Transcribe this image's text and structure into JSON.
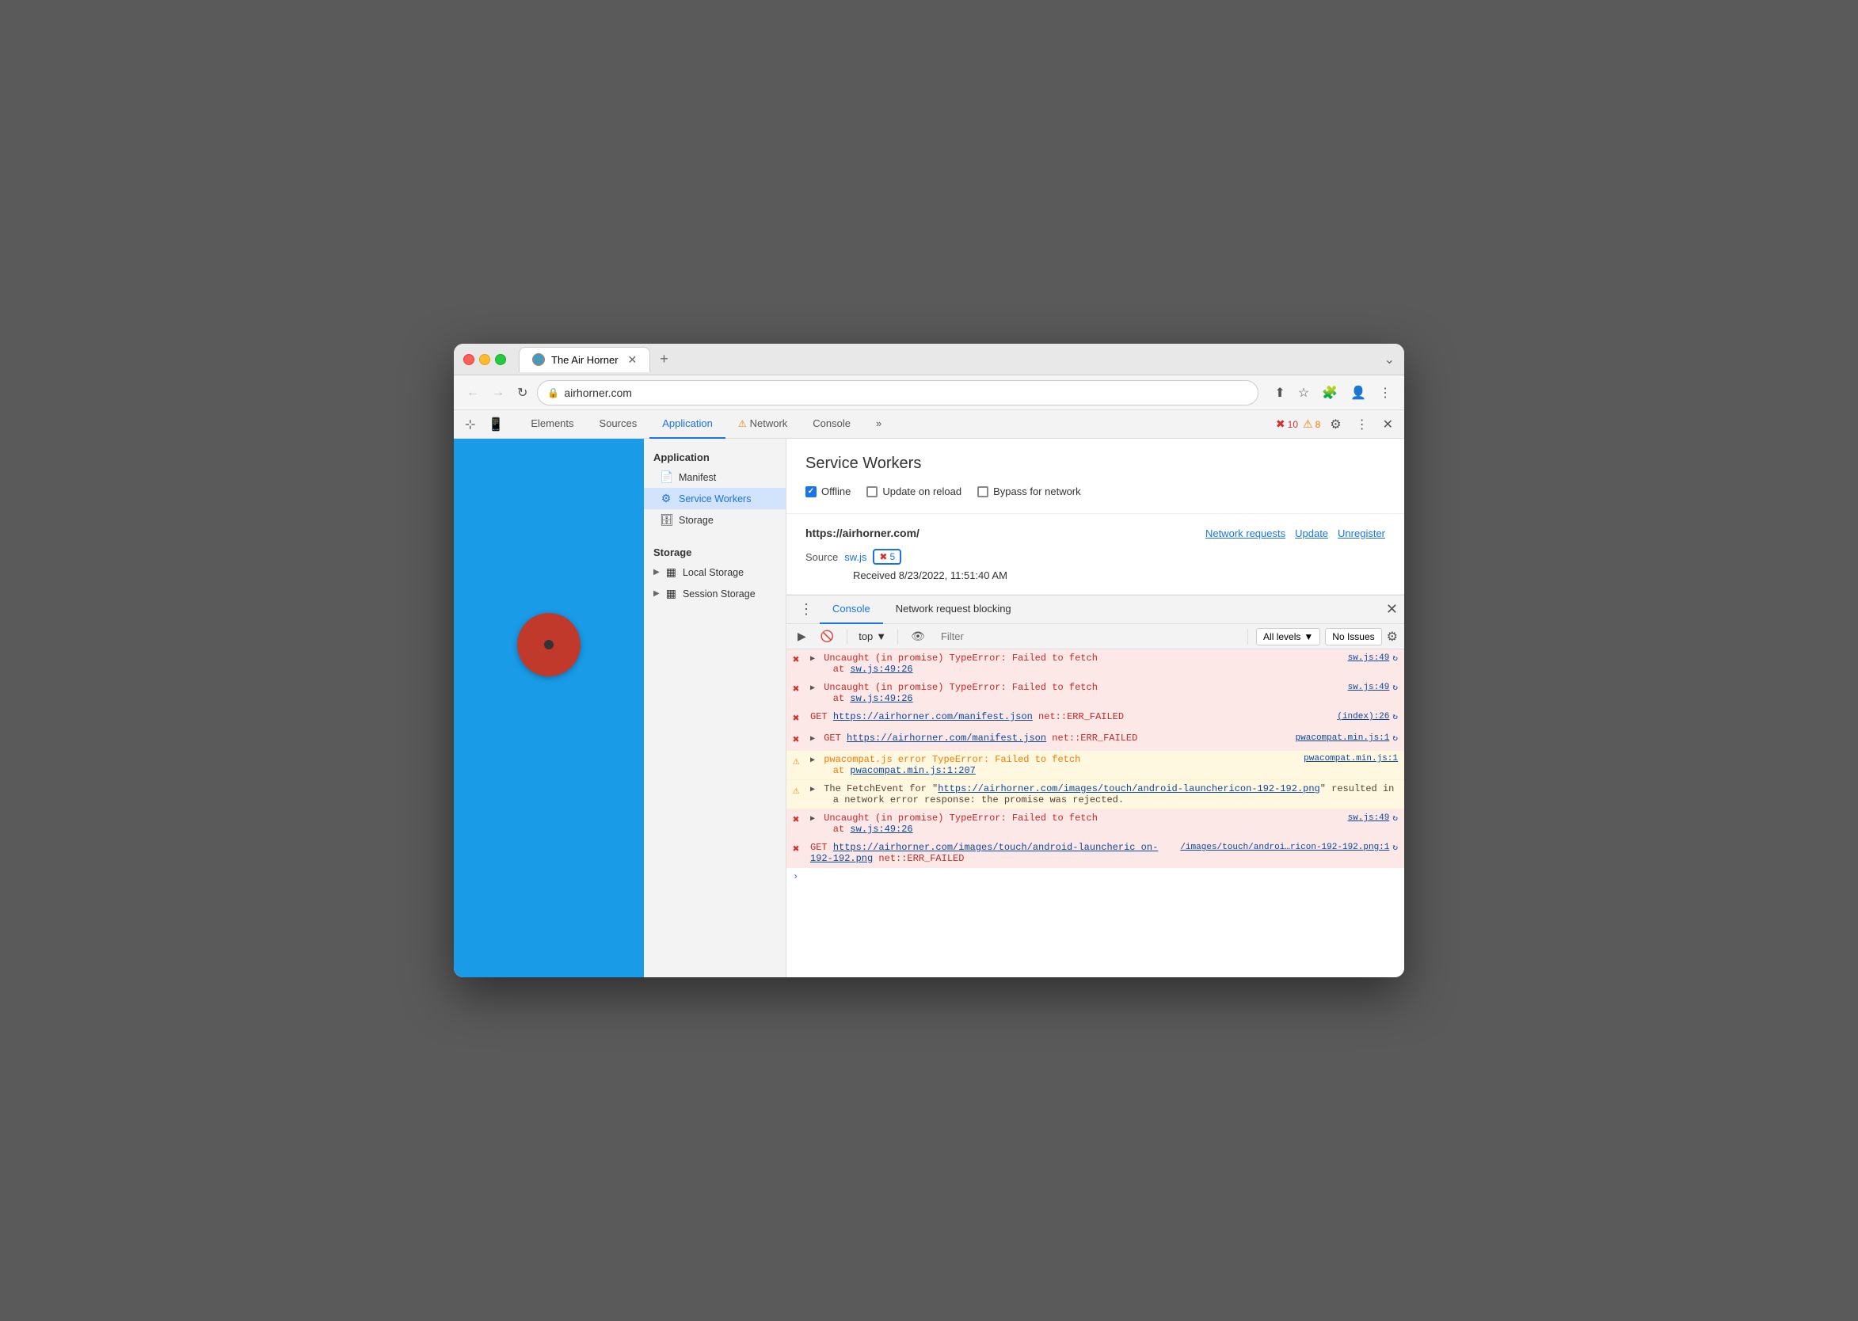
{
  "window": {
    "title": "The Air Horner",
    "close_label": "✕",
    "new_tab_label": "+"
  },
  "addressbar": {
    "url": "airhorner.com",
    "back_label": "←",
    "forward_label": "→",
    "refresh_label": "↻"
  },
  "devtools": {
    "tabs": [
      {
        "id": "elements",
        "label": "Elements"
      },
      {
        "id": "sources",
        "label": "Sources"
      },
      {
        "id": "application",
        "label": "Application"
      },
      {
        "id": "network",
        "label": "Network"
      },
      {
        "id": "console",
        "label": "Console"
      }
    ],
    "active_tab": "application",
    "more_tabs_label": "»",
    "error_count": "10",
    "warning_count": "8",
    "settings_label": "⚙",
    "more_label": "⋮",
    "close_label": "✕"
  },
  "sidebar": {
    "section1_title": "Application",
    "items": [
      {
        "id": "manifest",
        "label": "Manifest",
        "icon": "📄"
      },
      {
        "id": "service-workers",
        "label": "Service Workers",
        "icon": "⚙",
        "active": true
      },
      {
        "id": "storage",
        "label": "Storage",
        "icon": "🗄"
      }
    ],
    "section2_title": "Storage",
    "storage_items": [
      {
        "id": "local-storage",
        "label": "Local Storage",
        "icon": "▦"
      },
      {
        "id": "session-storage",
        "label": "Session Storage",
        "icon": "▦"
      }
    ]
  },
  "service_workers_panel": {
    "title": "Service Workers",
    "offline_label": "Offline",
    "offline_checked": true,
    "update_on_reload_label": "Update on reload",
    "update_on_reload_checked": false,
    "bypass_for_network_label": "Bypass for network",
    "bypass_for_network_checked": false,
    "url": "https://airhorner.com/",
    "network_requests_label": "Network requests",
    "update_label": "Update",
    "unregister_label": "Unregister",
    "source_label": "Source",
    "source_file": "sw.js",
    "error_count": "5",
    "received_label": "Received 8/23/2022, 11:51:40 AM"
  },
  "console_panel": {
    "tab_label": "Console",
    "network_blocking_label": "Network request blocking",
    "close_label": "✕",
    "filter_placeholder": "Filter",
    "top_context": "top",
    "all_levels_label": "All levels",
    "no_issues_label": "No Issues",
    "messages": [
      {
        "type": "error",
        "expand": true,
        "text": "Uncaught (in promise) TypeError: Failed to fetch",
        "subtext": "at sw.js:49:26",
        "source": "sw.js:49"
      },
      {
        "type": "error",
        "expand": true,
        "text": "Uncaught (in promise) TypeError: Failed to fetch",
        "subtext": "at sw.js:49:26",
        "source": "sw.js:49"
      },
      {
        "type": "error",
        "expand": false,
        "text": "GET https://airhorner.com/manifest.json net::ERR_FAILED",
        "source": "(index):26"
      },
      {
        "type": "error",
        "expand": true,
        "text": "GET https://airhorner.com/manifest.json net::ERR_FAILED",
        "source": "pwacompat.min.js:1"
      },
      {
        "type": "warning",
        "expand": true,
        "text": "pwacompat.js error TypeError: Failed to fetch",
        "subtext": "at pwacompat.min.js:1:207",
        "source": "pwacompat.min.js:1"
      },
      {
        "type": "warning",
        "expand": true,
        "text": "The FetchEvent for \"https://airhorner.com/images/touch/android-launchericon-192-192.png\" resulted in",
        "subtext": "a network error response: the promise was rejected.",
        "source": ""
      },
      {
        "type": "error",
        "expand": true,
        "text": "Uncaught (in promise) TypeError: Failed to fetch",
        "subtext": "at sw.js:49:26",
        "source": "sw.js:49"
      },
      {
        "type": "error",
        "expand": false,
        "text": "GET https://airhorner.com/images/touch/android-launcheric on-192-192.png net::ERR_FAILED",
        "source": "/images/touch/androi…ricon-192-192.png:1"
      }
    ]
  }
}
